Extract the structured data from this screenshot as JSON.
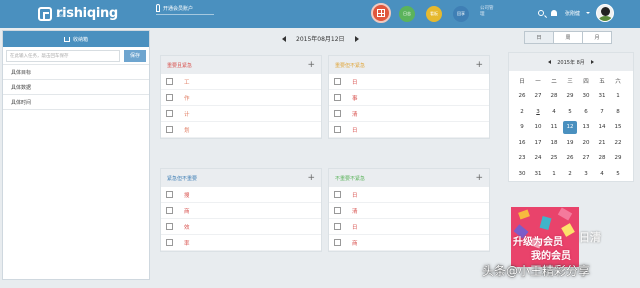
{
  "header": {
    "logo_text": "rishiqing",
    "logo_sub": ".com",
    "member_label": "开通会员账户",
    "today_label": "",
    "nav": [
      "日志",
      "看板",
      "回享"
    ],
    "company_label": "公司管理",
    "user_name": "张刚健"
  },
  "inbox": {
    "title": "收纳箱",
    "placeholder": "在此输入任务，敲击回车保存",
    "save_label": "保存",
    "items": [
      "具体目标",
      "具体数据",
      "具体时间"
    ]
  },
  "date_nav": {
    "label": "2015年08月12日"
  },
  "view_switch": {
    "day": "日",
    "week": "周",
    "month": "月"
  },
  "quadrants": [
    {
      "title": "重要且紧急",
      "items": [
        "工",
        "作",
        "计",
        "划"
      ],
      "color": "#d9534f"
    },
    {
      "title": "重要但不紧急",
      "items": [
        "日",
        "事",
        "清",
        "日"
      ],
      "color": "#e0a63c"
    },
    {
      "title": "紧急但不重要",
      "items": [
        "搜",
        "商",
        "效",
        "率"
      ],
      "color": "#3f7fb5"
    },
    {
      "title": "不重要不紧急",
      "items": [
        "日",
        "清",
        "日",
        "商"
      ],
      "color": "#5bb35b"
    }
  ],
  "calendar": {
    "label": "2015年 8月",
    "weekdays": [
      "日",
      "一",
      "二",
      "三",
      "四",
      "五",
      "六"
    ],
    "weeks": [
      [
        "26",
        "27",
        "28",
        "29",
        "30",
        "31",
        "1"
      ],
      [
        "2",
        "3",
        "4",
        "5",
        "6",
        "7",
        "8"
      ],
      [
        "9",
        "10",
        "11",
        "12",
        "13",
        "14",
        "15"
      ],
      [
        "16",
        "17",
        "18",
        "19",
        "20",
        "21",
        "22"
      ],
      [
        "23",
        "24",
        "25",
        "26",
        "27",
        "28",
        "29"
      ],
      [
        "30",
        "31",
        "1",
        "2",
        "3",
        "4",
        "5"
      ]
    ],
    "selected": "12"
  },
  "promo": {
    "line1": "升级为会员",
    "line2": "我的会员",
    "ext": "日清"
  },
  "watermark": "头条@小王精彩分享"
}
